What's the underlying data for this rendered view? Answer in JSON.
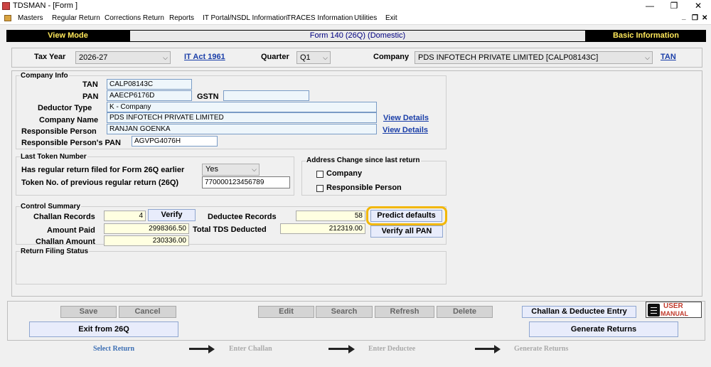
{
  "window": {
    "title": "TDSMAN - [Form ]",
    "min": "—",
    "restore": "❐",
    "close": "✕"
  },
  "menu": [
    "Masters",
    "Regular Return",
    "Corrections Return",
    "Reports",
    "IT Portal/NSDL Information",
    "TRACES Information",
    "Utilities",
    "Exit"
  ],
  "mdi": {
    "min": "_",
    "restore": "❐",
    "close": "✕"
  },
  "header": {
    "mode": "View Mode",
    "form": "Form 140 (26Q) (Domestic)",
    "basic": "Basic Information"
  },
  "top": {
    "tax_year_label": "Tax Year",
    "tax_year": "2026-27",
    "it_act": "IT Act 1961",
    "quarter_label": "Quarter",
    "quarter": "Q1",
    "company_label": "Company",
    "company": "PDS INFOTECH PRIVATE LIMITED [CALP08143C]",
    "tan_link": "TAN"
  },
  "company_info": {
    "title": "Company Info",
    "tan_label": "TAN",
    "tan": "CALP08143C",
    "pan_label": "PAN",
    "pan": "AAECP6176D",
    "gstn_label": "GSTN",
    "gstn": "",
    "deductor_type_label": "Deductor Type",
    "deductor_type": "K - Company",
    "company_name_label": "Company Name",
    "company_name": "PDS INFOTECH PRIVATE LIMITED",
    "view_details": "View Details",
    "responsible_label": "Responsible Person",
    "responsible": "RANJAN  GOENKA",
    "view_details2": "View Details",
    "resp_pan_label": "Responsible Person's PAN",
    "resp_pan": "AGVPG4076H"
  },
  "last_token": {
    "title": "Last Token Number",
    "filed_label": "Has regular return filed for Form 26Q earlier",
    "filed": "Yes",
    "token_label": "Token No. of previous regular return (26Q)",
    "token": "770000123456789"
  },
  "address_change": {
    "title": "Address Change since last return",
    "company": "Company",
    "responsible": "Responsible Person"
  },
  "control": {
    "title": "Control Summary",
    "challan_records_label": "Challan Records",
    "challan_records": "4",
    "verify": "Verify",
    "deductee_records_label": "Deductee Records",
    "deductee_records": "58",
    "predict": "Predict defaults",
    "amount_paid_label": "Amount Paid",
    "amount_paid": "2998366.50",
    "total_tds_label": "Total TDS Deducted",
    "total_tds": "212319.00",
    "verify_pan": "Verify all PAN",
    "challan_amount_label": "Challan Amount",
    "challan_amount": "230336.00"
  },
  "return_status": {
    "title": "Return Filing Status"
  },
  "buttons": {
    "save": "Save",
    "cancel": "Cancel",
    "edit": "Edit",
    "search": "Search",
    "refresh": "Refresh",
    "delete": "Delete",
    "challan_entry": "Challan & Deductee Entry",
    "user_manual_1": "USER",
    "user_manual_2": "MANUAL",
    "exit": "Exit from 26Q",
    "generate": "Generate Returns"
  },
  "workflow": [
    "Select Return",
    "Enter Challan",
    "Enter Deductee",
    "Generate Returns"
  ],
  "colors": {
    "header_bg": "#000000",
    "header_text": "#ffe85a",
    "link": "#1a3ea8",
    "highlight": "#f2b705"
  }
}
